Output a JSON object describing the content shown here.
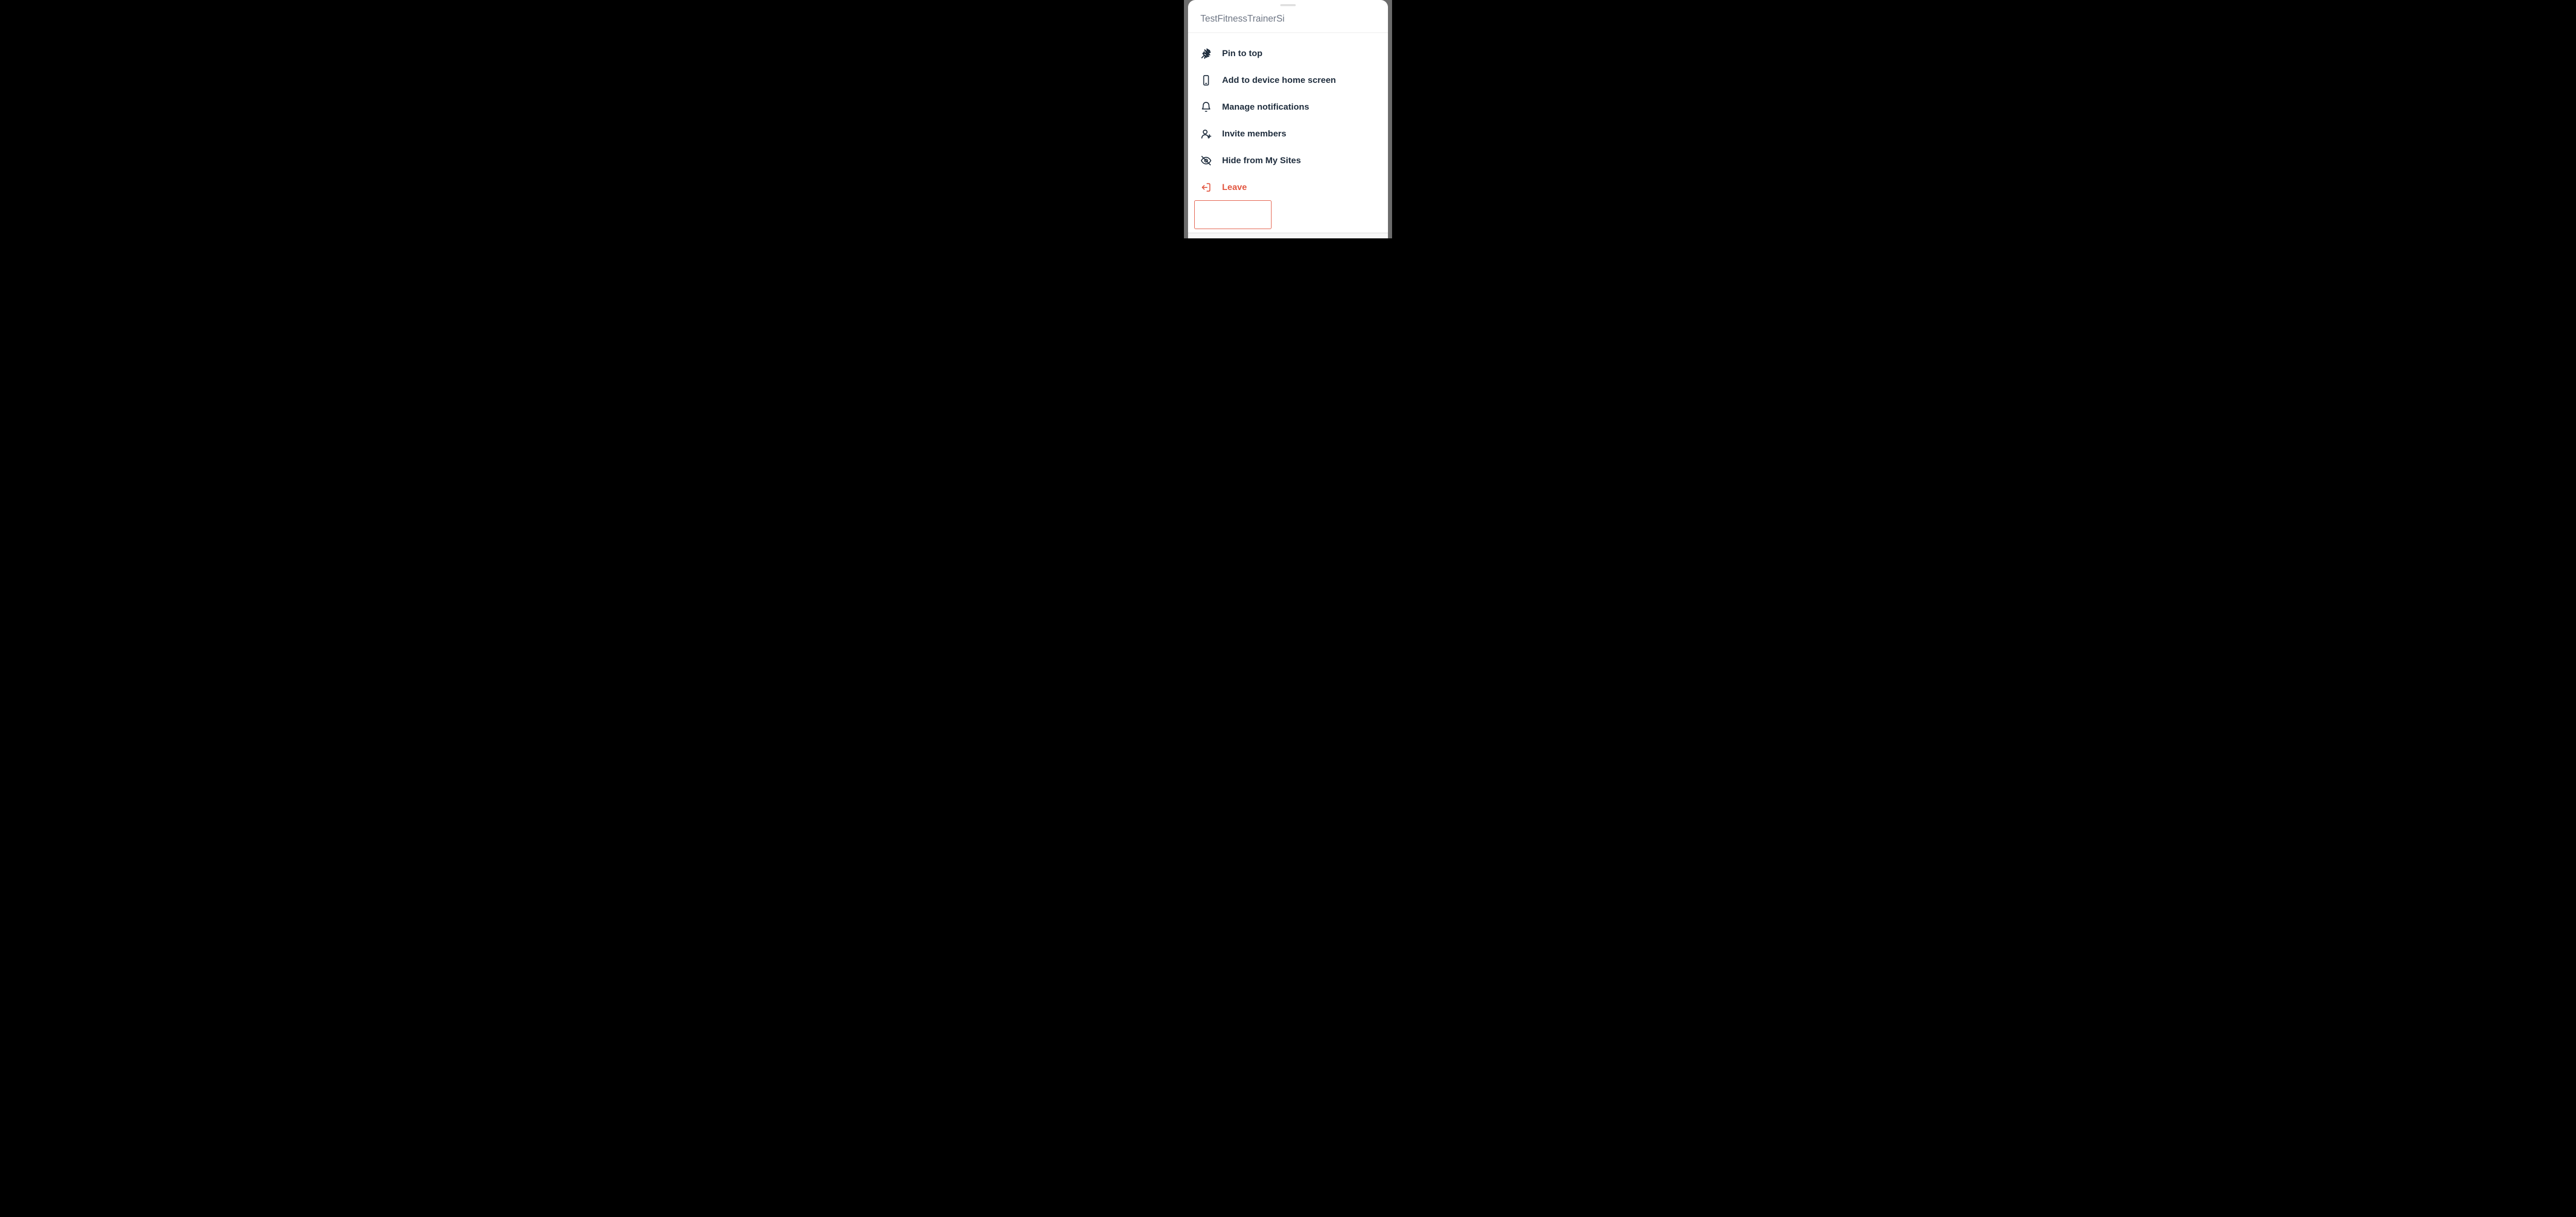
{
  "sheet": {
    "title": "TestFitnessTrainerSi"
  },
  "menu": {
    "items": [
      {
        "icon": "pin-icon",
        "label": "Pin to top"
      },
      {
        "icon": "device-icon",
        "label": "Add to device home screen"
      },
      {
        "icon": "bell-icon",
        "label": "Manage notifications"
      },
      {
        "icon": "invite-icon",
        "label": "Invite members"
      },
      {
        "icon": "hide-icon",
        "label": "Hide from My Sites"
      },
      {
        "icon": "leave-icon",
        "label": "Leave",
        "danger": true,
        "highlighted": true
      }
    ]
  }
}
